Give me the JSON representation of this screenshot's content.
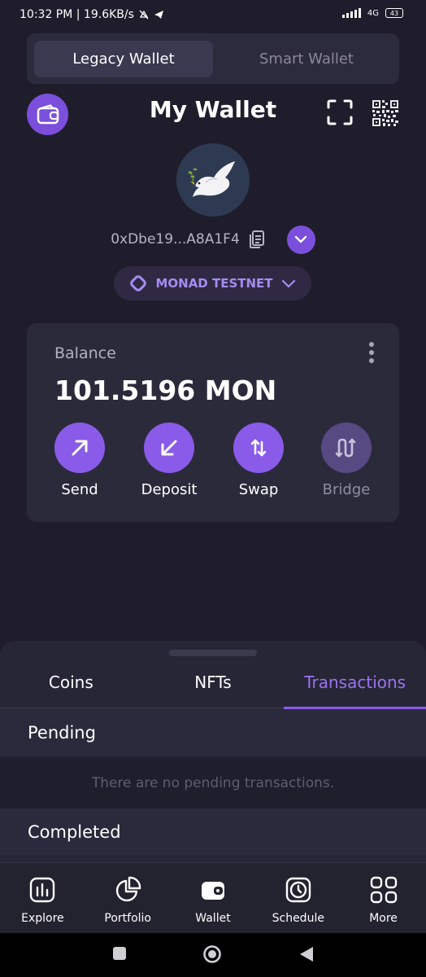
{
  "status_bar": {
    "time_speed": "10:32 PM | 19.6KB/s",
    "network_type": "4G",
    "battery": "43"
  },
  "wallet_toggle": {
    "options": [
      "Legacy Wallet",
      "Smart Wallet"
    ],
    "selected": "Legacy Wallet"
  },
  "header": {
    "title": "My Wallet"
  },
  "account": {
    "avatar_icon": "dove-icon",
    "address": "0xDbe19...A8A1F4"
  },
  "network": {
    "name": "MONAD TESTNET"
  },
  "balance_card": {
    "label": "Balance",
    "value": "101.5196 MON",
    "actions": [
      {
        "label": "Send",
        "icon": "arrow-up-right-icon",
        "enabled": true
      },
      {
        "label": "Deposit",
        "icon": "arrow-down-left-icon",
        "enabled": true
      },
      {
        "label": "Swap",
        "icon": "swap-vertical-icon",
        "enabled": true
      },
      {
        "label": "Bridge",
        "icon": "bridge-icon",
        "enabled": false
      }
    ]
  },
  "sheet": {
    "tabs": [
      "Coins",
      "NFTs",
      "Transactions"
    ],
    "active_tab": "Transactions",
    "pending_title": "Pending",
    "pending_empty": "There are no pending transactions.",
    "completed_title": "Completed"
  },
  "bottom_nav": {
    "items": [
      {
        "label": "Explore",
        "icon": "chart-icon"
      },
      {
        "label": "Portfolio",
        "icon": "pie-chart-icon"
      },
      {
        "label": "Wallet",
        "icon": "wallet-icon"
      },
      {
        "label": "Schedule",
        "icon": "clock-icon"
      },
      {
        "label": "More",
        "icon": "grid-icon"
      }
    ]
  },
  "colors": {
    "background": "#1f1d2b",
    "accent": "#8a5be8",
    "card": "#2b2a3b"
  }
}
